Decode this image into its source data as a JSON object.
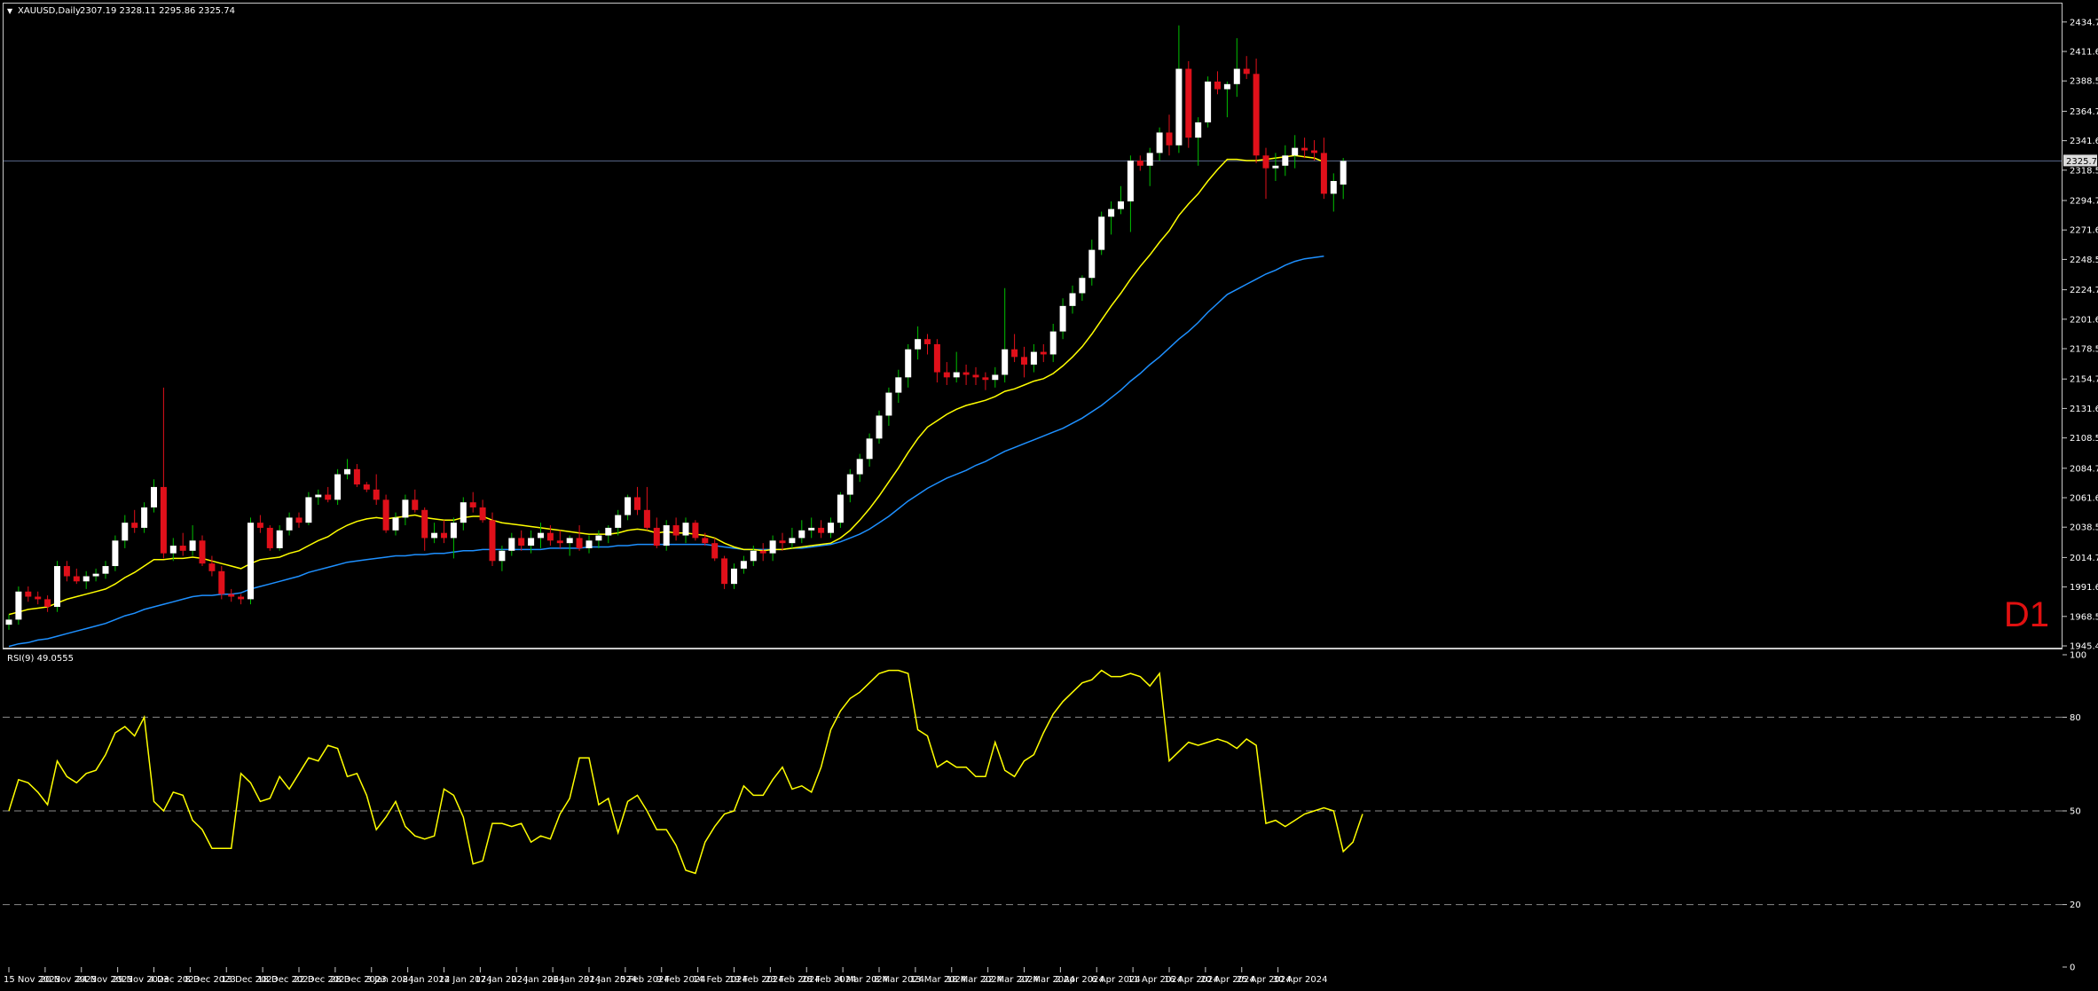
{
  "header": {
    "symbol_label": "XAUUSD,Daily",
    "ohlc_text": "2307.19 2328.11 2295.86 2325.74"
  },
  "timeframe_label": "D1",
  "rsi_label": "RSI(9) 49.0555",
  "colors": {
    "background": "#000000",
    "frame": "#c8c8c8",
    "bull_candle": "#ffffff",
    "bear_candle": "#e0101a",
    "wick_up": "#00c000",
    "wick_down": "#e0101a",
    "ma_fast": "#ffff00",
    "ma_slow": "#1e90ff",
    "rsi_line": "#ffff00",
    "current_price_line": "#5a6a8c"
  },
  "chart_data": [
    {
      "type": "candlestick",
      "title": "XAUUSD,Daily",
      "ylim": [
        1945.4,
        2445.0
      ],
      "y_ticks": [
        "2434.70",
        "2411.60",
        "2388.50",
        "2364.70",
        "2341.60",
        "2318.50",
        "2294.70",
        "2271.60",
        "2248.50",
        "2224.70",
        "2201.60",
        "2178.50",
        "2154.70",
        "2131.60",
        "2108.50",
        "2084.70",
        "2061.60",
        "2038.50",
        "2014.70",
        "1991.60",
        "1968.50",
        "1945.40"
      ],
      "current_price": "2325.74",
      "x_labels": [
        "15 Nov 2023",
        "20 Nov 2023",
        "24 Nov 2023",
        "29 Nov 2023",
        "4 Dec 2023",
        "8 Dec 2023",
        "13 Dec 2023",
        "18 Dec 2023",
        "22 Dec 2023",
        "28 Dec 2023",
        "3 Jan 2024",
        "8 Jan 2024",
        "12 Jan 2024",
        "17 Jan 2024",
        "22 Jan 2024",
        "26 Jan 2024",
        "31 Jan 2024",
        "5 Feb 2024",
        "9 Feb 2024",
        "14 Feb 2024",
        "19 Feb 2024",
        "23 Feb 2024",
        "28 Feb 2024",
        "4 Mar 2024",
        "8 Mar 2024",
        "13 Mar 2024",
        "18 Mar 2024",
        "22 Mar 2024",
        "27 Mar 2024",
        "2 Apr 2024",
        "6 Apr 2024",
        "11 Apr 2024",
        "16 Apr 2024",
        "20 Apr 2024",
        "25 Apr 2024",
        "30 Apr 2024"
      ],
      "ohlc": [
        [
          1962,
          1970,
          1958,
          1966
        ],
        [
          1966,
          1992,
          1962,
          1988
        ],
        [
          1988,
          1992,
          1980,
          1984
        ],
        [
          1984,
          1988,
          1978,
          1982
        ],
        [
          1982,
          1985,
          1972,
          1976
        ],
        [
          1976,
          2012,
          1972,
          2008
        ],
        [
          2008,
          2012,
          1996,
          2000
        ],
        [
          2000,
          2006,
          1994,
          1996
        ],
        [
          1996,
          2004,
          1990,
          2000
        ],
        [
          2000,
          2006,
          1996,
          2002
        ],
        [
          2002,
          2012,
          1998,
          2008
        ],
        [
          2008,
          2032,
          2004,
          2028
        ],
        [
          2028,
          2048,
          2022,
          2042
        ],
        [
          2042,
          2052,
          2034,
          2038
        ],
        [
          2038,
          2058,
          2034,
          2054
        ],
        [
          2054,
          2076,
          2050,
          2070
        ],
        [
          2070,
          2148,
          2014,
          2018
        ],
        [
          2018,
          2030,
          2012,
          2024
        ],
        [
          2024,
          2034,
          2016,
          2020
        ],
        [
          2020,
          2040,
          2016,
          2028
        ],
        [
          2028,
          2032,
          2008,
          2010
        ],
        [
          2010,
          2016,
          2000,
          2004
        ],
        [
          2004,
          2008,
          1982,
          1986
        ],
        [
          1986,
          1990,
          1980,
          1984
        ],
        [
          1984,
          1986,
          1978,
          1982
        ],
        [
          1982,
          2046,
          1978,
          2042
        ],
        [
          2042,
          2048,
          2034,
          2038
        ],
        [
          2038,
          2040,
          2020,
          2022
        ],
        [
          2022,
          2040,
          2020,
          2036
        ],
        [
          2036,
          2050,
          2032,
          2046
        ],
        [
          2046,
          2050,
          2038,
          2042
        ],
        [
          2042,
          2066,
          2040,
          2062
        ],
        [
          2062,
          2068,
          2056,
          2064
        ],
        [
          2064,
          2070,
          2058,
          2060
        ],
        [
          2060,
          2084,
          2056,
          2080
        ],
        [
          2080,
          2092,
          2076,
          2084
        ],
        [
          2084,
          2088,
          2070,
          2072
        ],
        [
          2072,
          2074,
          2066,
          2068
        ],
        [
          2068,
          2080,
          2056,
          2060
        ],
        [
          2060,
          2064,
          2034,
          2036
        ],
        [
          2036,
          2050,
          2032,
          2046
        ],
        [
          2046,
          2064,
          2040,
          2060
        ],
        [
          2060,
          2068,
          2050,
          2052
        ],
        [
          2052,
          2054,
          2020,
          2030
        ],
        [
          2030,
          2042,
          2026,
          2034
        ],
        [
          2034,
          2044,
          2026,
          2030
        ],
        [
          2030,
          2046,
          2014,
          2042
        ],
        [
          2042,
          2062,
          2036,
          2058
        ],
        [
          2058,
          2066,
          2050,
          2054
        ],
        [
          2054,
          2060,
          2042,
          2044
        ],
        [
          2044,
          2050,
          2008,
          2012
        ],
        [
          2012,
          2024,
          2004,
          2020
        ],
        [
          2020,
          2034,
          2016,
          2030
        ],
        [
          2030,
          2036,
          2020,
          2024
        ],
        [
          2024,
          2036,
          2018,
          2030
        ],
        [
          2030,
          2042,
          2022,
          2034
        ],
        [
          2034,
          2040,
          2024,
          2028
        ],
        [
          2028,
          2036,
          2022,
          2026
        ],
        [
          2026,
          2032,
          2016,
          2030
        ],
        [
          2030,
          2040,
          2020,
          2022
        ],
        [
          2022,
          2032,
          2018,
          2028
        ],
        [
          2028,
          2036,
          2022,
          2032
        ],
        [
          2032,
          2040,
          2026,
          2038
        ],
        [
          2038,
          2052,
          2032,
          2048
        ],
        [
          2048,
          2064,
          2044,
          2062
        ],
        [
          2062,
          2070,
          2048,
          2052
        ],
        [
          2052,
          2070,
          2036,
          2038
        ],
        [
          2038,
          2046,
          2022,
          2024
        ],
        [
          2024,
          2044,
          2020,
          2040
        ],
        [
          2040,
          2046,
          2028,
          2032
        ],
        [
          2032,
          2046,
          2026,
          2042
        ],
        [
          2042,
          2044,
          2028,
          2030
        ],
        [
          2030,
          2034,
          2024,
          2026
        ],
        [
          2026,
          2030,
          2012,
          2014
        ],
        [
          2014,
          2016,
          1990,
          1994
        ],
        [
          1994,
          2010,
          1990,
          2006
        ],
        [
          2006,
          2016,
          2002,
          2012
        ],
        [
          2012,
          2024,
          2008,
          2020
        ],
        [
          2020,
          2026,
          2012,
          2018
        ],
        [
          2018,
          2032,
          2012,
          2028
        ],
        [
          2028,
          2034,
          2020,
          2026
        ],
        [
          2026,
          2038,
          2022,
          2030
        ],
        [
          2030,
          2044,
          2026,
          2036
        ],
        [
          2036,
          2046,
          2030,
          2038
        ],
        [
          2038,
          2044,
          2030,
          2034
        ],
        [
          2034,
          2046,
          2030,
          2042
        ],
        [
          2042,
          2066,
          2038,
          2064
        ],
        [
          2064,
          2084,
          2058,
          2080
        ],
        [
          2080,
          2096,
          2074,
          2092
        ],
        [
          2092,
          2112,
          2086,
          2108
        ],
        [
          2108,
          2130,
          2104,
          2126
        ],
        [
          2126,
          2148,
          2118,
          2144
        ],
        [
          2144,
          2162,
          2136,
          2156
        ],
        [
          2156,
          2182,
          2148,
          2178
        ],
        [
          2178,
          2196,
          2170,
          2186
        ],
        [
          2186,
          2190,
          2174,
          2182
        ],
        [
          2182,
          2186,
          2152,
          2160
        ],
        [
          2160,
          2168,
          2150,
          2156
        ],
        [
          2156,
          2176,
          2152,
          2160
        ],
        [
          2160,
          2166,
          2150,
          2158
        ],
        [
          2158,
          2164,
          2150,
          2156
        ],
        [
          2156,
          2160,
          2146,
          2154
        ],
        [
          2154,
          2164,
          2148,
          2158
        ],
        [
          2158,
          2226,
          2152,
          2178
        ],
        [
          2178,
          2190,
          2168,
          2172
        ],
        [
          2172,
          2180,
          2156,
          2166
        ],
        [
          2166,
          2182,
          2160,
          2176
        ],
        [
          2176,
          2182,
          2168,
          2174
        ],
        [
          2174,
          2198,
          2168,
          2192
        ],
        [
          2192,
          2218,
          2186,
          2212
        ],
        [
          2212,
          2228,
          2206,
          2222
        ],
        [
          2222,
          2236,
          2216,
          2234
        ],
        [
          2234,
          2264,
          2228,
          2256
        ],
        [
          2256,
          2286,
          2252,
          2282
        ],
        [
          2282,
          2294,
          2268,
          2288
        ],
        [
          2288,
          2306,
          2284,
          2294
        ],
        [
          2294,
          2330,
          2270,
          2326
        ],
        [
          2326,
          2330,
          2318,
          2322
        ],
        [
          2322,
          2336,
          2306,
          2332
        ],
        [
          2332,
          2352,
          2326,
          2348
        ],
        [
          2348,
          2362,
          2330,
          2338
        ],
        [
          2338,
          2432,
          2332,
          2398
        ],
        [
          2398,
          2404,
          2336,
          2344
        ],
        [
          2344,
          2360,
          2322,
          2356
        ],
        [
          2356,
          2392,
          2352,
          2388
        ],
        [
          2388,
          2396,
          2378,
          2382
        ],
        [
          2382,
          2388,
          2360,
          2386
        ],
        [
          2386,
          2422,
          2376,
          2398
        ],
        [
          2398,
          2408,
          2390,
          2394
        ],
        [
          2394,
          2406,
          2324,
          2330
        ],
        [
          2330,
          2336,
          2296,
          2320
        ],
        [
          2320,
          2332,
          2310,
          2322
        ],
        [
          2322,
          2338,
          2314,
          2330
        ],
        [
          2330,
          2346,
          2320,
          2336
        ],
        [
          2336,
          2344,
          2328,
          2334
        ],
        [
          2334,
          2342,
          2326,
          2332
        ],
        [
          2332,
          2344,
          2296,
          2300
        ],
        [
          2300,
          2316,
          2286,
          2310
        ],
        [
          2307.19,
          2328.11,
          2295.86,
          2325.74
        ]
      ],
      "ma_fast": [
        1970,
        1972,
        1974,
        1975,
        1976,
        1979,
        1982,
        1984,
        1986,
        1988,
        1990,
        1994,
        1999,
        2003,
        2008,
        2013,
        2013,
        2014,
        2014,
        2015,
        2014,
        2012,
        2010,
        2008,
        2006,
        2010,
        2013,
        2014,
        2015,
        2018,
        2020,
        2024,
        2028,
        2031,
        2036,
        2040,
        2043,
        2045,
        2046,
        2045,
        2046,
        2047,
        2048,
        2046,
        2045,
        2044,
        2044,
        2046,
        2047,
        2047,
        2044,
        2042,
        2041,
        2040,
        2039,
        2038,
        2037,
        2036,
        2035,
        2034,
        2033,
        2033,
        2033,
        2034,
        2036,
        2037,
        2036,
        2034,
        2035,
        2034,
        2034,
        2033,
        2032,
        2030,
        2026,
        2023,
        2021,
        2021,
        2020,
        2021,
        2021,
        2022,
        2023,
        2024,
        2025,
        2026,
        2030,
        2036,
        2044,
        2053,
        2063,
        2074,
        2085,
        2097,
        2108,
        2117,
        2122,
        2127,
        2131,
        2134,
        2136,
        2138,
        2141,
        2145,
        2147,
        2150,
        2153,
        2155,
        2159,
        2165,
        2172,
        2180,
        2190,
        2201,
        2212,
        2222,
        2233,
        2243,
        2252,
        2262,
        2271,
        2283,
        2292,
        2300,
        2310,
        2319,
        2327,
        2327,
        2326,
        2326,
        2327,
        2328,
        2329,
        2330,
        2329,
        2328,
        2325
      ],
      "ma_slow": [
        1945,
        1947,
        1948,
        1950,
        1951,
        1953,
        1955,
        1957,
        1959,
        1961,
        1963,
        1966,
        1969,
        1971,
        1974,
        1976,
        1978,
        1980,
        1982,
        1984,
        1985,
        1985,
        1986,
        1986,
        1987,
        1990,
        1992,
        1994,
        1996,
        1998,
        2000,
        2003,
        2005,
        2007,
        2009,
        2011,
        2012,
        2013,
        2014,
        2015,
        2016,
        2016,
        2017,
        2017,
        2018,
        2018,
        2019,
        2020,
        2020,
        2021,
        2021,
        2021,
        2021,
        2021,
        2021,
        2021,
        2022,
        2022,
        2022,
        2022,
        2023,
        2023,
        2023,
        2024,
        2024,
        2025,
        2025,
        2025,
        2025,
        2025,
        2025,
        2025,
        2025,
        2024,
        2023,
        2022,
        2021,
        2021,
        2021,
        2021,
        2021,
        2022,
        2022,
        2023,
        2024,
        2025,
        2027,
        2030,
        2033,
        2037,
        2042,
        2047,
        2053,
        2059,
        2064,
        2069,
        2073,
        2077,
        2080,
        2083,
        2087,
        2090,
        2094,
        2098,
        2101,
        2104,
        2107,
        2110,
        2113,
        2116,
        2120,
        2124,
        2129,
        2134,
        2140,
        2146,
        2153,
        2159,
        2166,
        2172,
        2179,
        2186,
        2192,
        2199,
        2207,
        2214,
        2221,
        2225,
        2229,
        2233,
        2237,
        2240,
        2244,
        2247,
        2249,
        2250,
        2251
      ]
    },
    {
      "type": "line",
      "title": "RSI(9) 49.0555",
      "ylim": [
        0,
        100
      ],
      "y_ticks": [
        "100",
        "80",
        "50",
        "20",
        "0"
      ],
      "levels": [
        80,
        50,
        20
      ],
      "values": [
        50,
        60,
        59,
        56,
        52,
        66,
        61,
        59,
        62,
        63,
        68,
        75,
        77,
        74,
        80,
        53,
        50,
        56,
        55,
        47,
        44,
        38,
        38,
        38,
        62,
        59,
        53,
        54,
        61,
        57,
        62,
        67,
        66,
        71,
        70,
        61,
        62,
        55,
        44,
        48,
        53,
        45,
        42,
        41,
        42,
        57,
        55,
        48,
        33,
        34,
        46,
        46,
        45,
        46,
        40,
        42,
        41,
        49,
        54,
        67,
        67,
        52,
        54,
        43,
        53,
        55,
        50,
        44,
        44,
        39,
        31,
        30,
        40,
        45,
        49,
        50,
        58,
        55,
        55,
        60,
        64,
        57,
        58,
        56,
        64,
        76,
        82,
        86,
        88,
        91,
        94,
        95,
        95,
        94,
        76,
        74,
        64,
        66,
        64,
        64,
        61,
        61,
        72,
        63,
        61,
        66,
        68,
        75,
        81,
        85,
        88,
        91,
        92,
        95,
        93,
        93,
        94,
        93,
        90,
        94,
        66,
        69,
        72,
        71,
        72,
        73,
        72,
        70,
        73,
        71,
        46,
        47,
        45,
        47,
        49,
        50,
        51,
        50,
        37,
        40,
        49
      ]
    }
  ]
}
